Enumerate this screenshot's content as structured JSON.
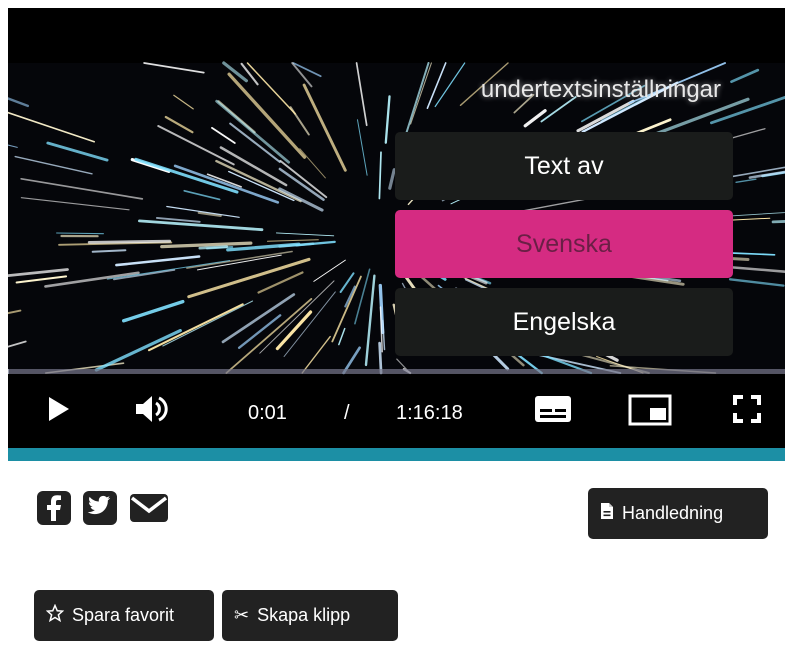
{
  "subtitle_menu": {
    "title": "undertextsinställningar",
    "options": [
      {
        "label": "Text av",
        "selected": false
      },
      {
        "label": "Svenska",
        "selected": true
      },
      {
        "label": "Engelska",
        "selected": false
      }
    ]
  },
  "player": {
    "current_time": "0:01",
    "separator": "/",
    "duration": "1:16:18",
    "progress_fraction": 0.0002,
    "controls": [
      "play-icon",
      "volume-icon",
      "subtitles-icon",
      "pip-icon",
      "fullscreen-icon"
    ]
  },
  "social": [
    "facebook-icon",
    "twitter-icon",
    "email-icon"
  ],
  "buttons": {
    "guide": "Handledning",
    "favorite": "Spara favorit",
    "clip": "Skapa klipp"
  },
  "colors": {
    "accent": "#1c8fa5",
    "selected_option": "#d52b82",
    "button_bg": "#222222",
    "menu_option_bg": "#1a1c1b"
  }
}
